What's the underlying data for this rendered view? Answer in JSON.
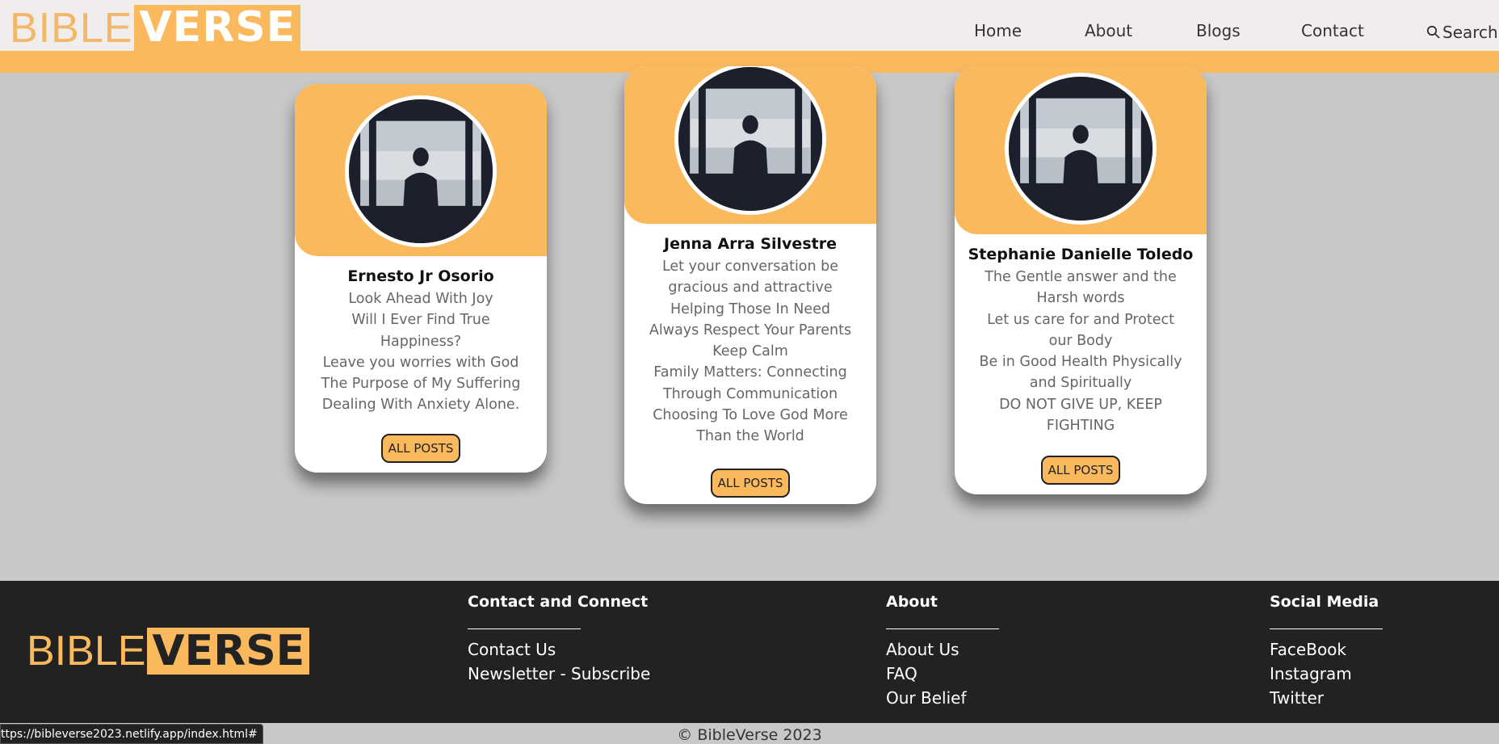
{
  "header": {
    "logo_part1": "BIBLE",
    "logo_part2": "VERSE",
    "nav": [
      {
        "label": "Home"
      },
      {
        "label": "About"
      },
      {
        "label": "Blogs"
      },
      {
        "label": "Contact"
      }
    ],
    "search_label": "Search",
    "search_icon": "search-icon"
  },
  "cards": [
    {
      "name": "Ernesto Jr Osorio",
      "posts": [
        "Look Ahead With Joy",
        "Will I Ever Find True Happiness?",
        "Leave you worries with God",
        "The Purpose of My Suffering",
        "Dealing With Anxiety Alone."
      ],
      "button_label": "ALL POSTS"
    },
    {
      "name": "Jenna Arra Silvestre",
      "posts": [
        "Let your conversation be gracious and attractive",
        "Helping Those In Need",
        "Always Respect Your Parents",
        "Keep Calm",
        "Family Matters: Connecting Through Communication",
        "Choosing To Love God More Than the World"
      ],
      "button_label": "ALL POSTS"
    },
    {
      "name": "Stephanie Danielle Toledo",
      "posts": [
        "The Gentle answer and the Harsh words",
        "Let us care for and Protect our Body",
        "Be in Good Health Physically and Spiritually",
        "DO NOT GIVE UP, KEEP FIGHTING"
      ],
      "button_label": "ALL POSTS"
    }
  ],
  "footer": {
    "logo_part1": "BIBLE",
    "logo_part2": "VERSE",
    "columns": [
      {
        "heading": "Contact and Connect",
        "links": [
          "Contact Us",
          "Newsletter - Subscribe"
        ]
      },
      {
        "heading": "About",
        "links": [
          "About Us",
          "FAQ",
          "Our Belief"
        ]
      },
      {
        "heading": "Social Media",
        "links": [
          "FaceBook",
          "Instagram",
          "Twitter"
        ]
      }
    ],
    "copyright": "© BibleVerse 2023"
  },
  "status_bar": {
    "url": "ttps://bibleverse2023.netlify.app/index.html#"
  },
  "colors": {
    "accent": "#fbb95e",
    "page_bg": "#c8c8c8",
    "header_bg": "#f2eded",
    "footer_bg": "#222222"
  }
}
